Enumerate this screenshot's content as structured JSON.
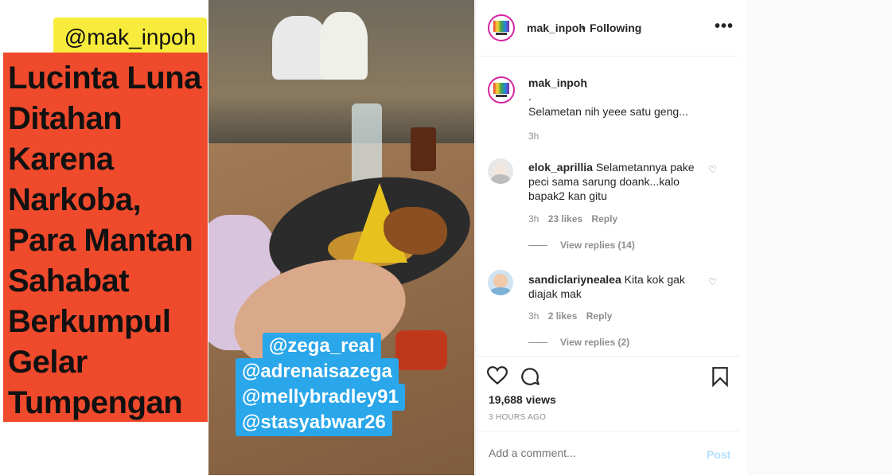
{
  "media": {
    "handle_tag": "@mak_inpoh",
    "headline_lines": [
      "Lucinta Luna",
      "Ditahan",
      "Karena",
      "Narkoba,",
      "Para Mantan",
      "Sahabat",
      "Berkumpul",
      "Gelar",
      "Tumpengan"
    ],
    "mentions": [
      "@zega_real",
      "@adrenaisazega",
      "@mellybradley91",
      "@stasyabwar26"
    ],
    "colors": {
      "headline_bg": "#f04a2c",
      "tag_bg": "#f7ec3c",
      "mention_bg": "#2aa6ea"
    }
  },
  "header": {
    "username": "mak_inpoh",
    "separator": "•",
    "follow_status": "Following",
    "more_icon": "more-horizontal-icon"
  },
  "caption": {
    "username": "mak_inpoh",
    "first_line": ".",
    "second_line": ".",
    "text": "Selametan nih yeee satu geng...",
    "time": "3h"
  },
  "comments": [
    {
      "username": "elok_aprillia",
      "text": "Selametannya pake peci sama sarung doank...kalo bapak2 kan gitu",
      "time": "3h",
      "likes": "23 likes",
      "reply": "Reply",
      "view_replies": "View replies (14)"
    },
    {
      "username": "sandiclariynealea",
      "text": "Kita kok gak diajak mak",
      "time": "3h",
      "likes": "2 likes",
      "reply": "Reply",
      "view_replies": "View replies (2)"
    }
  ],
  "stats": {
    "views": "19,688 views",
    "posted": "3 HOURS AGO"
  },
  "add_comment": {
    "placeholder": "Add a comment...",
    "post_label": "Post"
  }
}
